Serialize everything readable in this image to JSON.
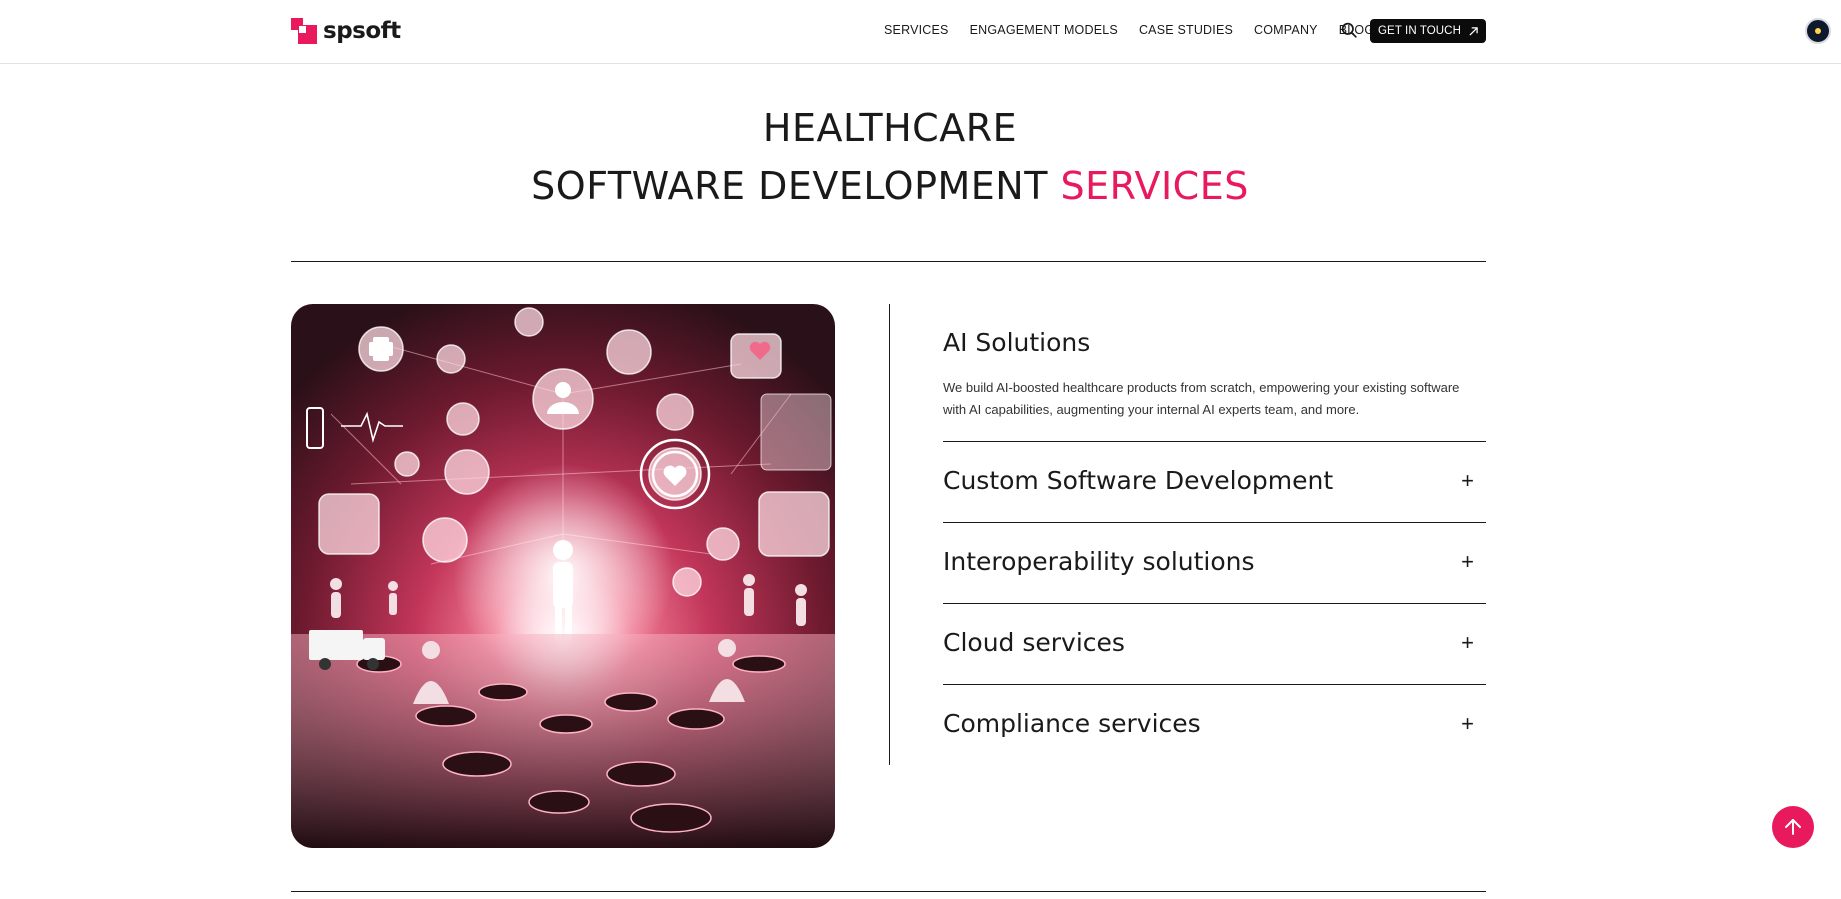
{
  "brand": {
    "name": "spsoft",
    "accent": "#e8195c"
  },
  "nav": {
    "items": [
      "SERVICES",
      "ENGAGEMENT MODELS",
      "CASE STUDIES",
      "COMPANY",
      "BLOG"
    ],
    "cta_label": "GET IN TOUCH",
    "search_icon": "search-icon",
    "accessibility_icon": "accessibility-icon"
  },
  "hero": {
    "title_line1": "HEALTHCARE",
    "title_line2_main": "SOFTWARE DEVELOPMENT",
    "title_line2_accent": "SERVICES"
  },
  "accordion": {
    "open_item": {
      "title": "AI Solutions",
      "description": "We build AI-boosted healthcare products from scratch, empowering your existing software with AI capabilities, augmenting your internal AI experts team, and more."
    },
    "items": [
      {
        "label": "Custom Software Development",
        "icon": "+"
      },
      {
        "label": "Interoperability solutions",
        "icon": "+"
      },
      {
        "label": "Cloud services",
        "icon": "+"
      },
      {
        "label": "Compliance services",
        "icon": "+"
      }
    ]
  },
  "scroll_top_icon": "arrow-up-icon"
}
